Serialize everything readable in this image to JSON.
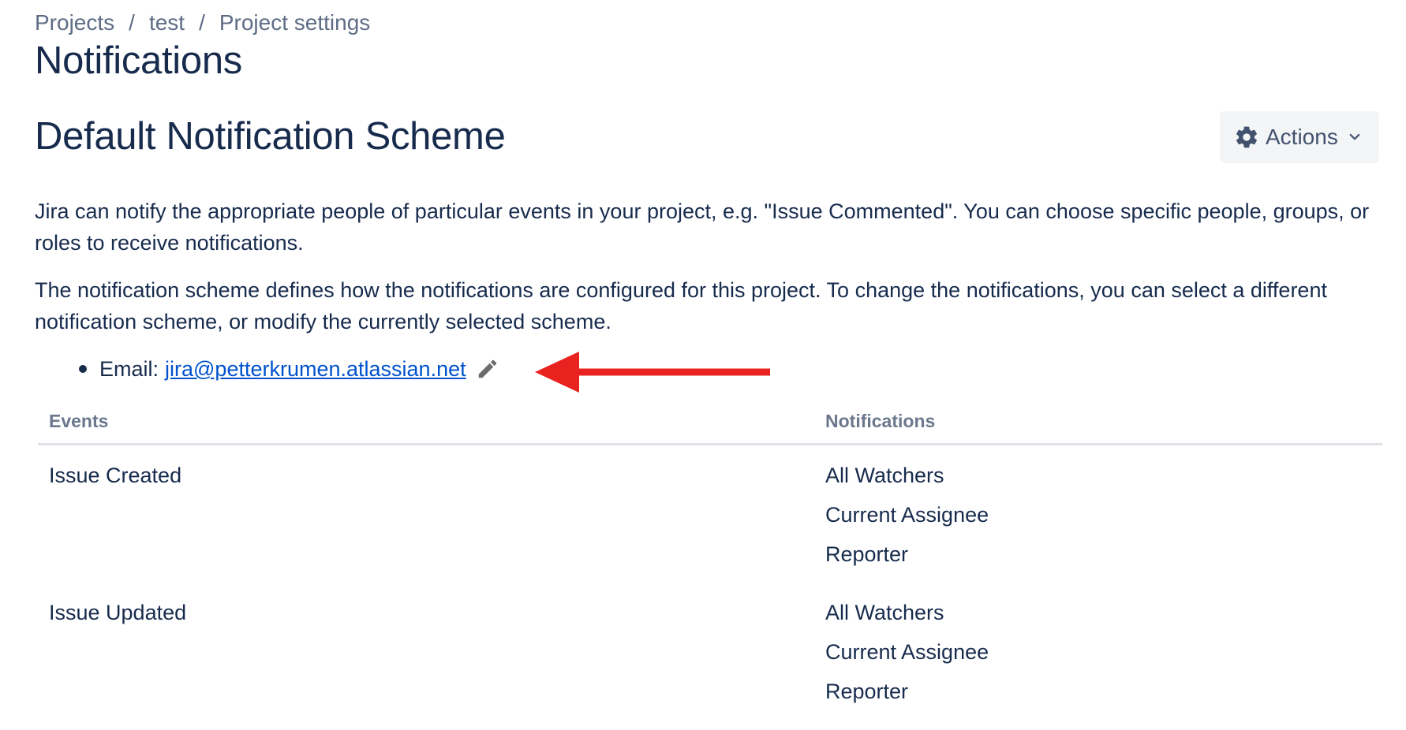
{
  "breadcrumbs": {
    "items": [
      "Projects",
      "test",
      "Project settings"
    ],
    "separator": "/"
  },
  "page_title": "Notifications",
  "scheme": {
    "title": "Default Notification Scheme",
    "actions_label": "Actions",
    "actions_icon": "gear-icon"
  },
  "description": {
    "para1": "Jira can notify the appropriate people of particular events in your project, e.g. \"Issue Commented\". You can choose specific people, groups, or roles to receive notifications.",
    "para2": "The notification scheme defines how the notifications are configured for this project. To change the notifications, you can select a different notification scheme, or modify the currently selected scheme."
  },
  "email": {
    "label": "Email:",
    "address": "jira@petterkrumen.atlassian.net"
  },
  "table": {
    "headers": {
      "events": "Events",
      "notifications": "Notifications"
    },
    "rows": [
      {
        "event": "Issue Created",
        "notifications": [
          "All Watchers",
          "Current Assignee",
          "Reporter"
        ]
      },
      {
        "event": "Issue Updated",
        "notifications": [
          "All Watchers",
          "Current Assignee",
          "Reporter"
        ]
      }
    ]
  },
  "colors": {
    "text_primary": "#172b4d",
    "text_subtle": "#5e6c84",
    "link": "#0052cc",
    "button_bg": "#f4f5f7",
    "annotation_arrow": "#e8231f"
  }
}
